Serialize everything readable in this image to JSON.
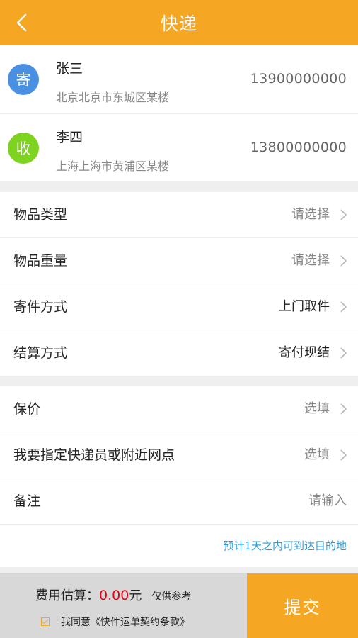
{
  "header": {
    "title": "快递",
    "back_icon": "chevron-left-icon"
  },
  "sender": {
    "badge": "寄",
    "name": "张三",
    "address": "北京北京市东城区某楼",
    "phone": "13900000000",
    "badge_color": "#4a90e2"
  },
  "receiver": {
    "badge": "收",
    "name": "李四",
    "address": "上海上海市黄浦区某楼",
    "phone": "13800000000",
    "badge_color": "#7ed321"
  },
  "details": [
    {
      "label": "物品类型",
      "value": "请选择"
    },
    {
      "label": "物品重量",
      "value": "请选择"
    },
    {
      "label": "寄件方式",
      "value": "上门取件"
    },
    {
      "label": "结算方式",
      "value": "寄付现结"
    }
  ],
  "extras": [
    {
      "label": "保价",
      "value": "选填"
    },
    {
      "label": "我要指定快递员或附近网点",
      "value": "选填"
    },
    {
      "label": "备注",
      "value": "请输入"
    }
  ],
  "estimate_note": "预计1天之内可到达目的地",
  "footer": {
    "fee_label": "费用估算：",
    "fee_amount": "0.00",
    "fee_unit": "元",
    "fee_ref": "仅供参考",
    "agree_text": "我同意《快件运单契约条款》",
    "agree_checked": true,
    "submit_label": "提交"
  },
  "colors": {
    "accent": "#f5a623",
    "link": "#2a9ad6",
    "price": "#e60012"
  }
}
